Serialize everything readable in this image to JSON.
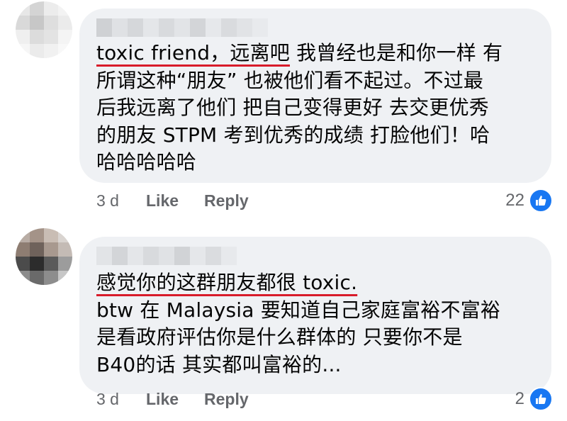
{
  "comments": [
    {
      "lines": [
        {
          "underlined": "toxic friend，远离吧",
          "rest": " 我曾经也是和你一样 有"
        },
        {
          "text": "所谓这种“朋友” 也被他们看不起过。不过最"
        },
        {
          "text": "后我远离了他们 把自己变得更好 去交更优秀"
        },
        {
          "text": "的朋友 STPM 考到优秀的成绩 打脸他们！哈"
        },
        {
          "text": "哈哈哈哈哈"
        }
      ],
      "time": "3 d",
      "like_label": "Like",
      "reply_label": "Reply",
      "reaction_count": "22",
      "reaction_icon": "thumbs-up-icon"
    },
    {
      "lines": [
        {
          "underlined": "感觉你的这群朋友都很 toxic.",
          "rest": ""
        },
        {
          "text": "btw 在 Malaysia 要知道自己家庭富裕不富裕"
        },
        {
          "text": "是看政府评估你是什么群体的 只要你不是"
        },
        {
          "text": "B40的话 其实都叫富裕的..."
        }
      ],
      "time": "3 d",
      "like_label": "Like",
      "reply_label": "Reply",
      "reaction_count": "2",
      "reaction_icon": "thumbs-up-icon"
    }
  ],
  "colors": {
    "bubble": "#eff1f4",
    "meta_text": "#65676b",
    "underline": "#d81b2a",
    "like_badge": "#1877f2"
  }
}
